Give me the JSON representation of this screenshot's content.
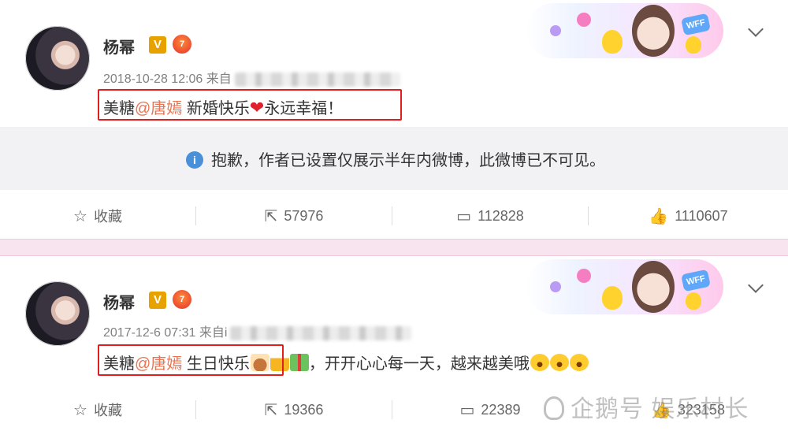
{
  "posts": [
    {
      "username": "杨幂",
      "vip_badge": "V",
      "level_badge": "lv7",
      "timestamp": "2018-10-28 12:06",
      "source_prefix": "来自",
      "source_fragment": "",
      "content_prefix": "美糖",
      "mention": "@唐嫣",
      "content_main": " 新婚快乐",
      "content_after_heart": "永远幸福！",
      "notice": "抱歉，作者已设置仅展示半年内微博，此微博已不可见。",
      "actions": {
        "favorite": "收藏",
        "repost": "57976",
        "comment": "112828",
        "like": "1110607"
      }
    },
    {
      "username": "杨幂",
      "vip_badge": "V",
      "level_badge": "lv7",
      "timestamp": "2017-12-6 07:31",
      "source_prefix": "来自",
      "source_fragment": "i",
      "content_prefix": "美糖",
      "mention": "@唐嫣",
      "content_main": "  生日快乐",
      "content_tail": "，开开心心每一天，越来越美哦",
      "actions": {
        "favorite": "收藏",
        "repost": "19366",
        "comment": "22389",
        "like": "323158"
      }
    }
  ],
  "banner": {
    "tag": "WFF"
  },
  "watermark": "企鹅号 娱乐村长",
  "colors": {
    "mention": "#eb7350",
    "highlight_box": "#e01e1e",
    "vip_badge": "#e8a200"
  }
}
